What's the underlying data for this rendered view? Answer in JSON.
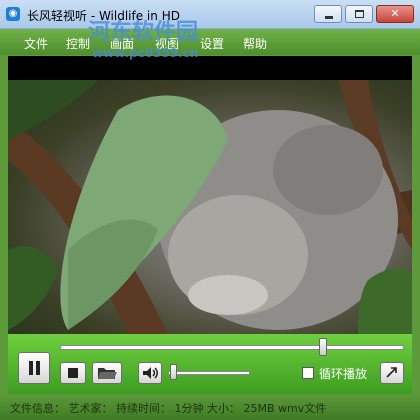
{
  "window": {
    "title": "长风轻视听 - Wildlife in HD",
    "icon": "app-logo-icon",
    "controls": {
      "minimize": "minimize-icon",
      "maximize": "maximize-icon",
      "close": "close-icon"
    }
  },
  "menu": [
    {
      "label": "文件"
    },
    {
      "label": "控制"
    },
    {
      "label": "画面"
    },
    {
      "label": "视图"
    },
    {
      "label": "设置"
    },
    {
      "label": "帮助"
    }
  ],
  "video": {
    "content": "koala sleeping on tree branch"
  },
  "controls": {
    "pause_icon": "pause-icon",
    "stop_icon": "stop-icon",
    "folder_icon": "open-folder-icon",
    "volume_icon": "speaker-icon",
    "expand_icon": "expand-arrow-icon",
    "progress_fraction": 0.77,
    "volume_fraction": 0.03,
    "loop_label": "循环播放",
    "loop_checked": false
  },
  "status": {
    "text": "文件信息：  艺术家：  持续时间：  1分钟  大小：  25MB  wmv文件"
  },
  "watermark": {
    "title": "河东软件园",
    "url": "www.pc0359.cn"
  },
  "colors": {
    "menu_green": "#5aa136",
    "control_green": "#4fb52a",
    "title_blue": "#b8d3ef"
  }
}
